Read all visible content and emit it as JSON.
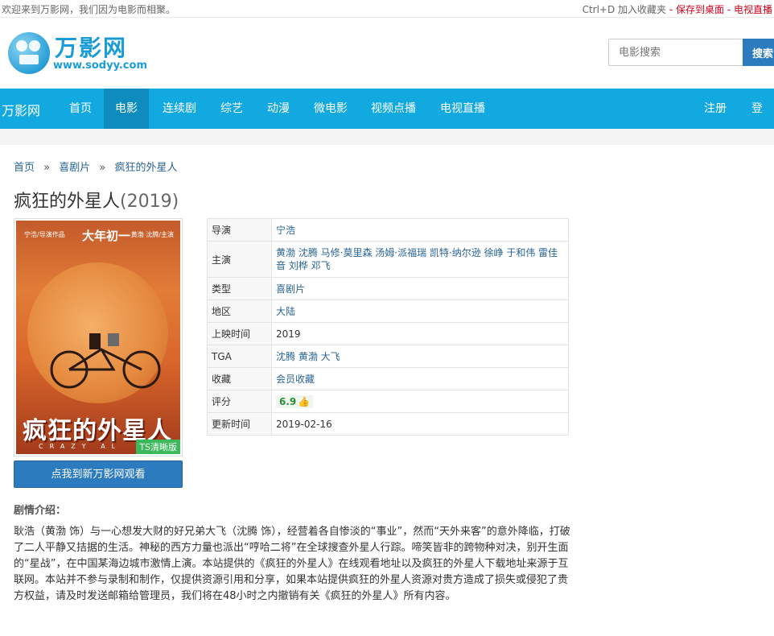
{
  "topbar": {
    "welcome": "欢迎来到万影网，我们因为电影而相聚。",
    "bookmark": "Ctrl+D 加入收藏夹",
    "dash1": " - ",
    "save_desktop": "保存到桌面",
    "dash2": " - ",
    "tv_live": "电视直播"
  },
  "header": {
    "logo_title": "万影网",
    "logo_url": "www.sodyy.com",
    "search_placeholder": "电影搜索",
    "search_button": "搜索"
  },
  "nav": {
    "brand": "万影网",
    "items": [
      "首页",
      "电影",
      "连续剧",
      "综艺",
      "动漫",
      "微电影",
      "视频点播",
      "电视直播"
    ],
    "active": "电影",
    "register": "注册",
    "login": "登录"
  },
  "breadcrumb": {
    "home": "首页",
    "sep": "»",
    "category": "喜剧片",
    "current": "疯狂的外星人"
  },
  "movie": {
    "title": "疯狂的外星人",
    "year": "(2019)",
    "poster": {
      "line1": "宁浩/导演作品",
      "line2": "大年初一",
      "line3": "黄渤 沈腾/主演",
      "main_title": "疯狂的外星人",
      "sub_title": "CRAZY AL",
      "badge": "TS清晰版"
    },
    "watch_button": "点我到新万影网观看",
    "info": {
      "director_label": "导演",
      "director": "宁浩",
      "cast_label": "主演",
      "cast": "黄渤 沈腾 马修·莫里森 汤姆·派福瑞 凯特·纳尔逊 徐峥 于和伟 雷佳音 刘桦 邓飞",
      "genre_label": "类型",
      "genre": "喜剧片",
      "region_label": "地区",
      "region": "大陆",
      "release_label": "上映时间",
      "release": "2019",
      "tga_label": "TGA",
      "tga": "沈腾 黄渤 大飞",
      "collect_label": "收藏",
      "collect": "会员收藏",
      "rating_label": "评分",
      "rating": "6.9",
      "updated_label": "更新时间",
      "updated": "2019-02-16"
    },
    "plot_label": "剧情介绍：",
    "plot": "耿浩（黄渤 饰）与一心想发大财的好兄弟大飞（沈腾 饰），经营着各自惨淡的“事业”，然而“天外来客”的意外降临，打破了二人平静又拮据的生活。神秘的西方力量也派出“哼哈二将”在全球搜查外星人行踪。啼笑皆非的跨物种对决，别开生面的“星战”，在中国某海边城市激情上演。本站提供的《疯狂的外星人》在线观看地址以及疯狂的外星人下载地址来源于互联网。本站并不参与录制和制作，仅提供资源引用和分享，如果本站提供疯狂的外星人资源对贵方造成了损失或侵犯了贵方权益，请及时发送邮箱给管理员，我们将在48小时之内撤销有关《疯狂的外星人》所有内容。"
  },
  "colors": {
    "nav_bg": "#12a8e0",
    "nav_active": "#0e8cbd",
    "button_blue": "#2c7bbf",
    "link_blue": "#2a6496",
    "red": "#d0021b",
    "badge_green": "#3cb95a"
  }
}
